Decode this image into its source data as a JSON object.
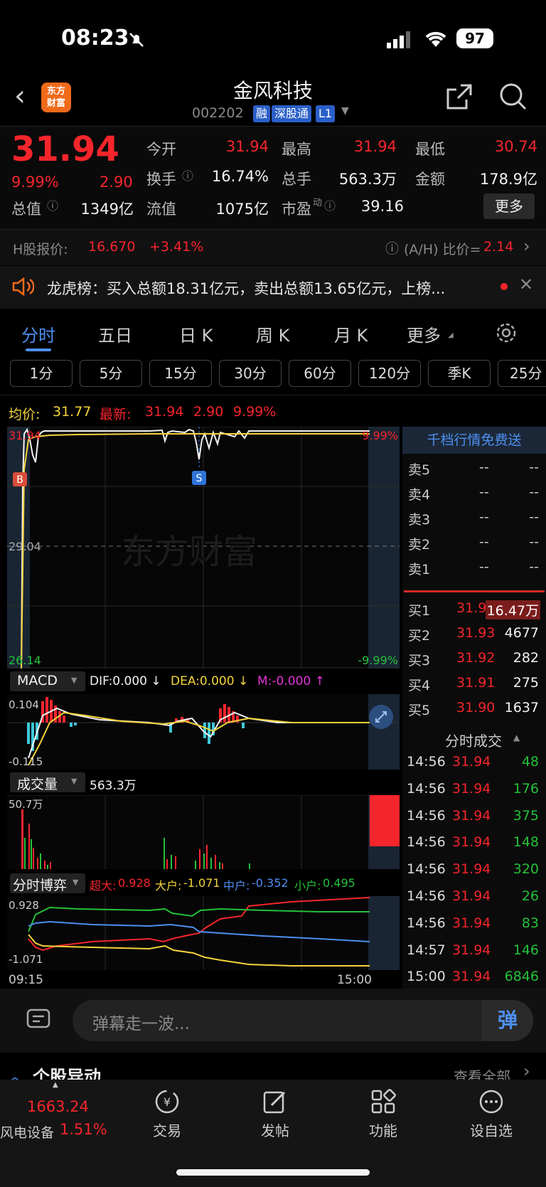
{
  "status": {
    "time": "08:23",
    "battery": "97"
  },
  "header": {
    "name": "金风科技",
    "code": "002202",
    "tags": [
      "融",
      "深股通",
      "L1"
    ]
  },
  "quote": {
    "price": "31.94",
    "change_pct": "9.99%",
    "change": "2.90",
    "open_label": "今开",
    "open": "31.94",
    "high_label": "最高",
    "high": "31.94",
    "low_label": "最低",
    "low": "30.74",
    "turnover_label": "换手",
    "turnover": "16.74%",
    "volume_label": "总手",
    "volume": "563.3万",
    "amount_label": "金额",
    "amount": "178.9亿",
    "mktcap_label": "总值",
    "mktcap": "1349亿",
    "float_label": "流值",
    "float": "1075亿",
    "pe_label": "市盈",
    "pe_sup": "动",
    "pe": "39.16",
    "more_label": "更多"
  },
  "hshare": {
    "label": "H股报价:",
    "price": "16.670",
    "change": "+3.41%",
    "ah_label": "(A/H) 比价=",
    "ah": "2.14"
  },
  "notice": {
    "text": "龙虎榜：买入总额18.31亿元，卖出总额13.65亿元，上榜..."
  },
  "tabs": [
    "分时",
    "五日",
    "日 K",
    "周 K",
    "月 K",
    "更多"
  ],
  "periods": [
    "1分",
    "5分",
    "15分",
    "30分",
    "60分",
    "120分",
    "季K",
    "25分"
  ],
  "chart_header": {
    "avg_label": "均价:",
    "avg": "31.77",
    "latest_label": "最新:",
    "latest": "31.94",
    "chg": "2.90",
    "chg_pct": "9.99%"
  },
  "chart_data": {
    "type": "line",
    "y_top": "31.94",
    "y_mid": "29.04",
    "y_bottom": "26.14",
    "pct_top": "9.99%",
    "pct_bottom": "-9.99%",
    "x_start": "09:15",
    "x_end": "15:00",
    "watermark": "东方财富",
    "markers": [
      "B",
      "S"
    ]
  },
  "macd": {
    "label": "MACD",
    "dif": "DIF:0.000 ↓",
    "dea": "DEA:0.000 ↓",
    "m": "M:-0.000 ↑",
    "top": "0.104",
    "bottom": "-0.115"
  },
  "volume": {
    "label": "成交量",
    "value": "563.3万",
    "max": "50.7万"
  },
  "game": {
    "label": "分时博弈",
    "super_label": "超大:",
    "super": "0.928",
    "big_label": "大户:",
    "big": "-1.071",
    "mid_label": "中户:",
    "mid": "-0.352",
    "small_label": "小户:",
    "small": "0.495",
    "top": "0.928",
    "bottom": "-1.071"
  },
  "orderbook": {
    "banner": "千档行情免费送",
    "asks": [
      {
        "label": "卖5",
        "price": "--",
        "vol": "--"
      },
      {
        "label": "卖4",
        "price": "--",
        "vol": "--"
      },
      {
        "label": "卖3",
        "price": "--",
        "vol": "--"
      },
      {
        "label": "卖2",
        "price": "--",
        "vol": "--"
      },
      {
        "label": "卖1",
        "price": "--",
        "vol": "--"
      }
    ],
    "bids": [
      {
        "label": "买1",
        "price": "31.94",
        "vol": "16.47万"
      },
      {
        "label": "买2",
        "price": "31.93",
        "vol": "4677"
      },
      {
        "label": "买3",
        "price": "31.92",
        "vol": "282"
      },
      {
        "label": "买4",
        "price": "31.91",
        "vol": "275"
      },
      {
        "label": "买5",
        "price": "31.90",
        "vol": "1637"
      }
    ]
  },
  "ticks": {
    "title": "分时成交",
    "rows": [
      {
        "time": "14:56",
        "price": "31.94",
        "vol": "48"
      },
      {
        "time": "14:56",
        "price": "31.94",
        "vol": "176"
      },
      {
        "time": "14:56",
        "price": "31.94",
        "vol": "375"
      },
      {
        "time": "14:56",
        "price": "31.94",
        "vol": "148"
      },
      {
        "time": "14:56",
        "price": "31.94",
        "vol": "320"
      },
      {
        "time": "14:56",
        "price": "31.94",
        "vol": "26"
      },
      {
        "time": "14:56",
        "price": "31.94",
        "vol": "83"
      },
      {
        "time": "14:57",
        "price": "31.94",
        "vol": "146"
      },
      {
        "time": "15:00",
        "price": "31.94",
        "vol": "6846"
      }
    ]
  },
  "comment": {
    "placeholder": "弹幕走一波...",
    "danmu": "弹"
  },
  "section": {
    "title": "个股异动",
    "view_all": "查看全部"
  },
  "bottom": {
    "index_value": "1663.24",
    "index_name": "风电设备",
    "index_pct": "1.51%",
    "trade": "交易",
    "post": "发帖",
    "func": "功能",
    "watch": "设自选"
  }
}
